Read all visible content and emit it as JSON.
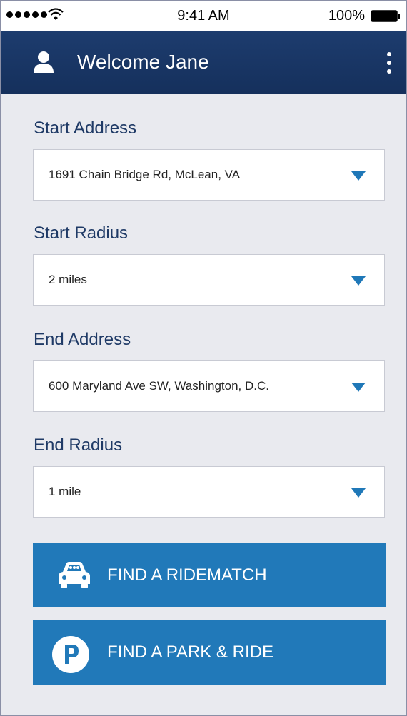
{
  "status_bar": {
    "time": "9:41 AM",
    "battery": "100%"
  },
  "header": {
    "title": "Welcome Jane",
    "user_icon": "user-icon",
    "menu_icon": "kebab-menu-icon",
    "background": "#1d3c6e"
  },
  "form": {
    "start_address": {
      "label": "Start Address",
      "value": "1691 Chain Bridge Rd, McLean, VA"
    },
    "start_radius": {
      "label": "Start Radius",
      "value": "2 miles"
    },
    "end_address": {
      "label": "End Address",
      "value": "600 Maryland Ave SW, Washington, D.C."
    },
    "end_radius": {
      "label": "End Radius",
      "value": "1 mile"
    }
  },
  "actions": {
    "ridematch": {
      "label": "FIND A RIDEMATCH",
      "icon": "car-icon"
    },
    "park_ride": {
      "label": "FIND A PARK & RIDE",
      "icon": "parking-icon"
    }
  },
  "colors": {
    "accent": "#2179b9",
    "label": "#1f3a66",
    "background": "#e9eaef"
  }
}
